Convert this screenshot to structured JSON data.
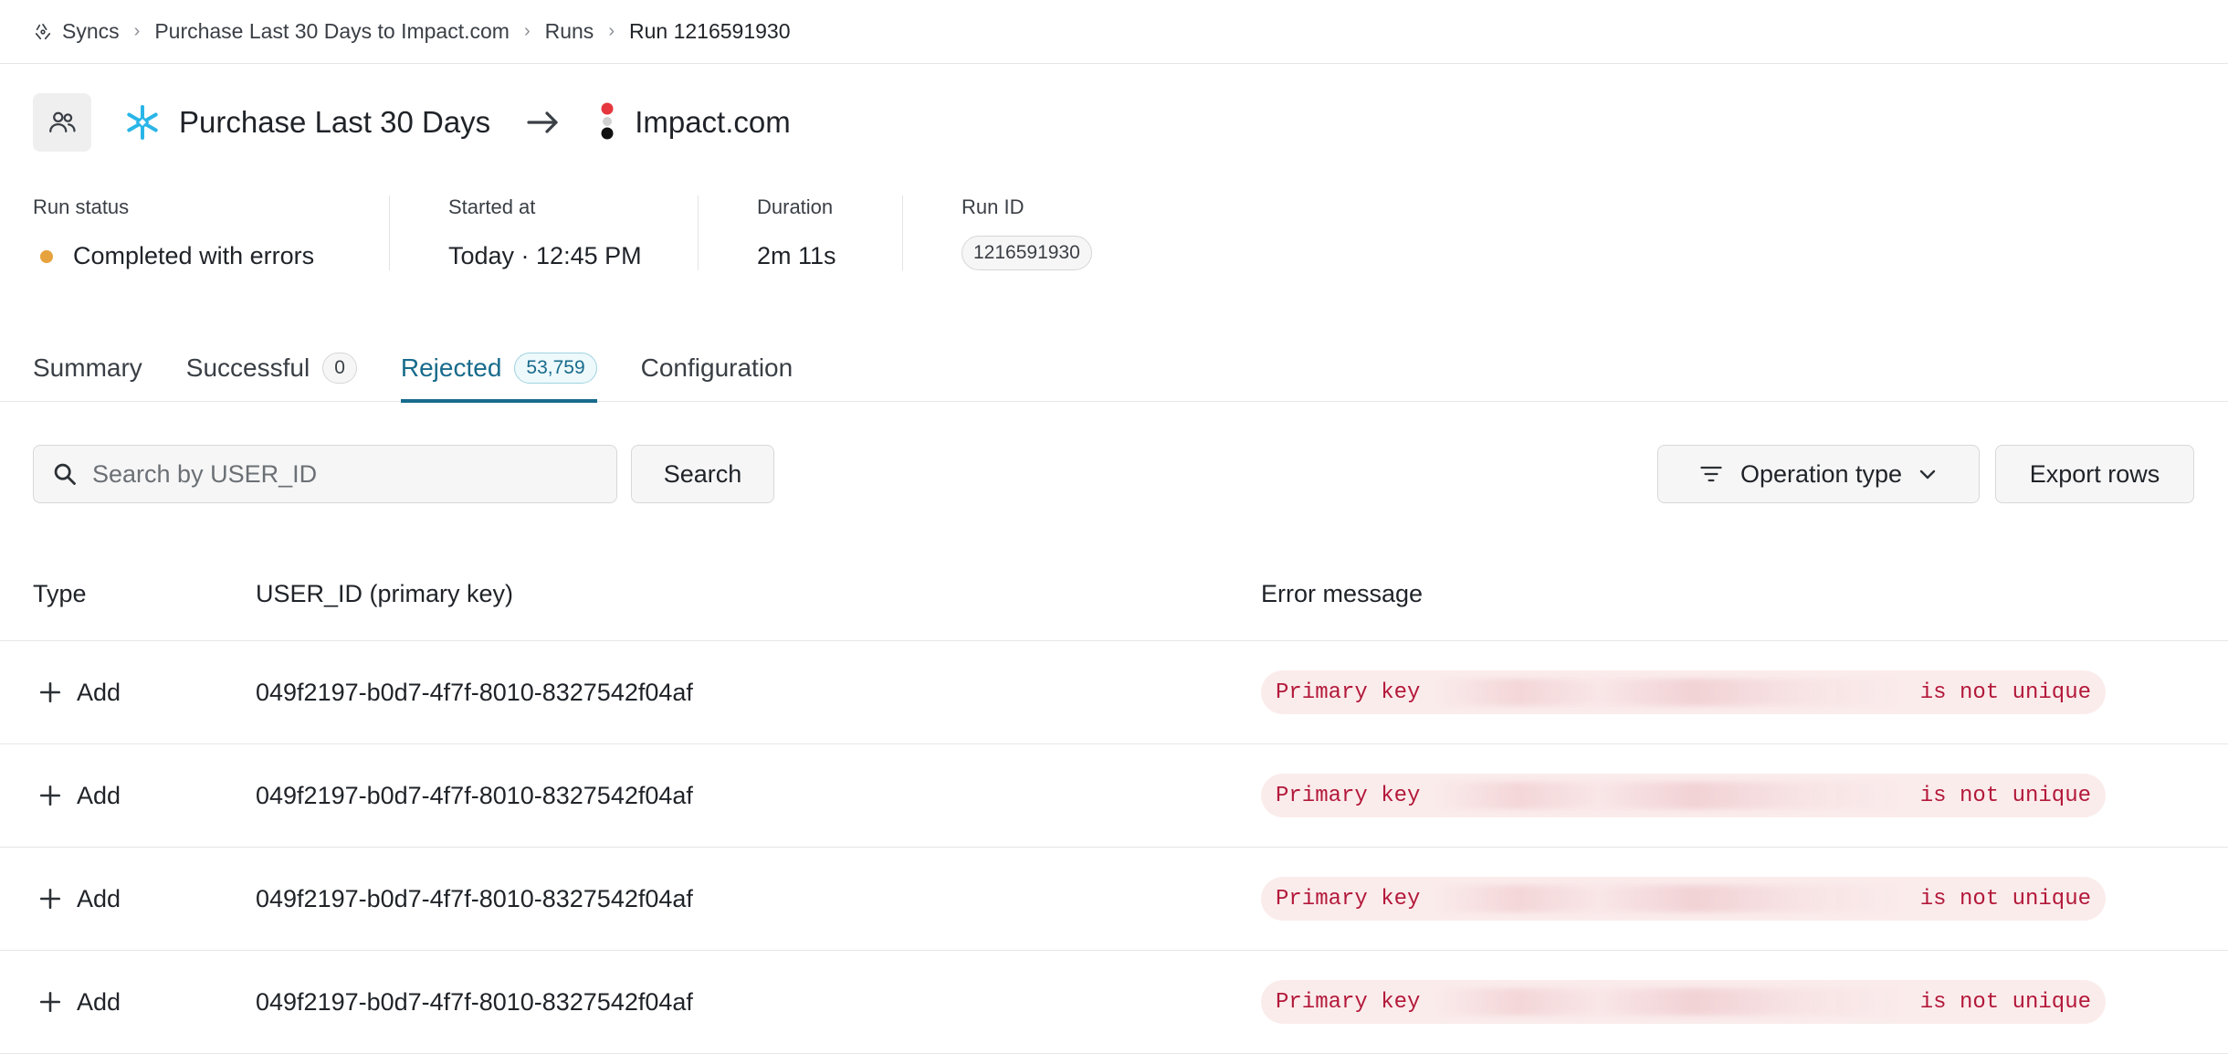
{
  "breadcrumb": {
    "items": [
      "Syncs",
      "Purchase Last 30 Days to Impact.com",
      "Runs",
      "Run 1216591930"
    ]
  },
  "header": {
    "source_model": "Purchase Last 30 Days",
    "destination": "Impact.com"
  },
  "meta": {
    "run_status_label": "Run status",
    "run_status_value": "Completed with errors",
    "run_status_color": "#e6a23c",
    "started_at_label": "Started at",
    "started_at_value": "Today · 12:45 PM",
    "duration_label": "Duration",
    "duration_value": "2m 11s",
    "run_id_label": "Run ID",
    "run_id_value": "1216591930"
  },
  "tabs": [
    {
      "label": "Summary",
      "count": null
    },
    {
      "label": "Successful",
      "count": "0"
    },
    {
      "label": "Rejected",
      "count": "53,759",
      "active": true
    },
    {
      "label": "Configuration",
      "count": null
    }
  ],
  "toolbar": {
    "search_placeholder": "Search by USER_ID",
    "search_button": "Search",
    "operation_type": "Operation type",
    "export_button": "Export rows"
  },
  "table": {
    "columns": [
      "Type",
      "USER_ID (primary key)",
      "Error message"
    ],
    "rows": [
      {
        "type": "Add",
        "user_id": "049f2197-b0d7-4f7f-8010-8327542f04af",
        "error_prefix": "Primary key",
        "error_suffix": "is not unique"
      },
      {
        "type": "Add",
        "user_id": "049f2197-b0d7-4f7f-8010-8327542f04af",
        "error_prefix": "Primary key",
        "error_suffix": "is not unique"
      },
      {
        "type": "Add",
        "user_id": "049f2197-b0d7-4f7f-8010-8327542f04af",
        "error_prefix": "Primary key",
        "error_suffix": "is not unique"
      },
      {
        "type": "Add",
        "user_id": "049f2197-b0d7-4f7f-8010-8327542f04af",
        "error_prefix": "Primary key",
        "error_suffix": "is not unique"
      }
    ]
  },
  "colors": {
    "accent": "#186b8c",
    "error_text": "#b3193a",
    "error_bg": "#fbecec"
  }
}
